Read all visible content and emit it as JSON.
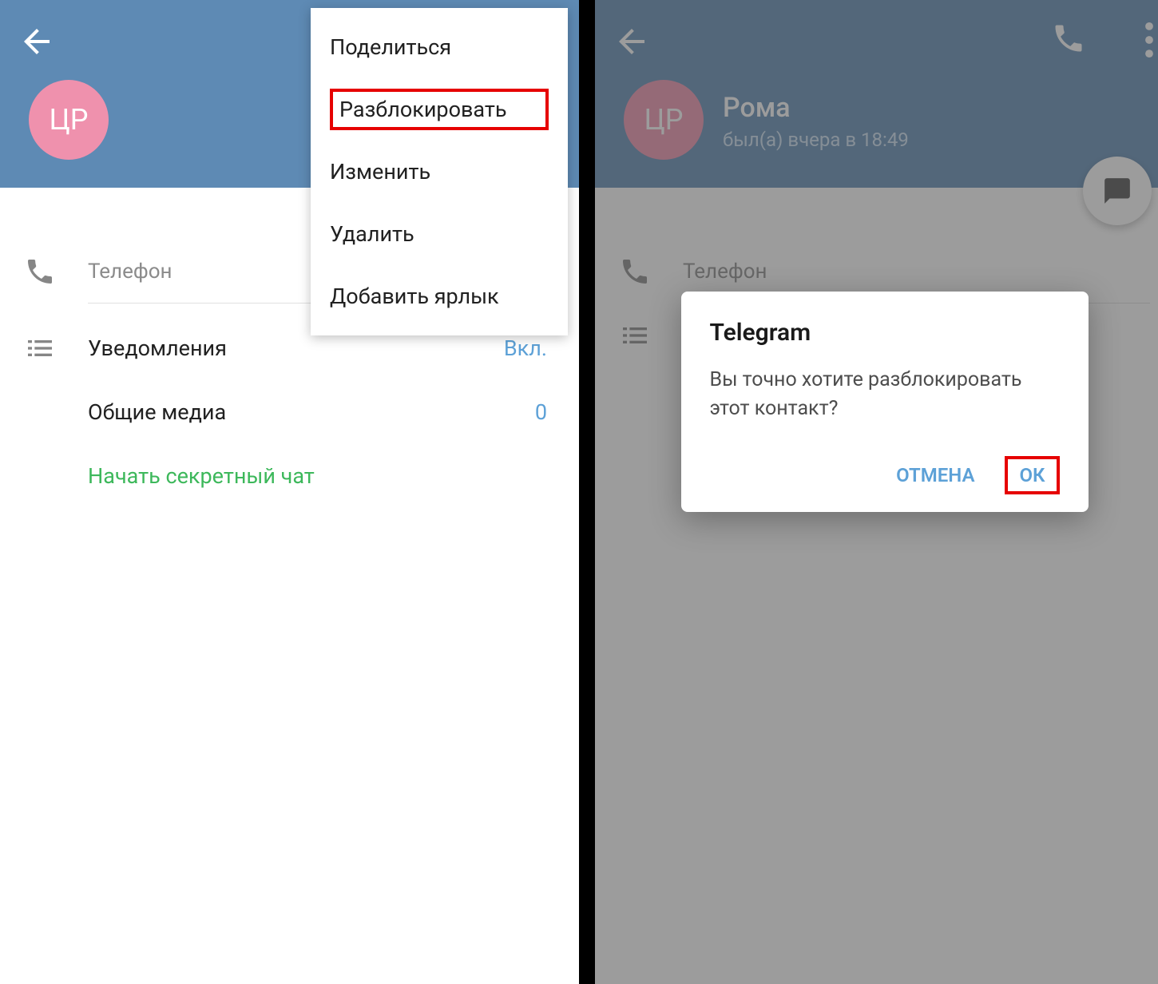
{
  "left": {
    "avatar_initials": "ЦР",
    "menu": {
      "share": "Поделиться",
      "unblock": "Разблокировать",
      "edit": "Изменить",
      "delete": "Удалить",
      "add_shortcut": "Добавить ярлык"
    },
    "phone_label": "Телефон",
    "notifications_label": "Уведомления",
    "notifications_value": "Вкл.",
    "shared_media_label": "Общие медиа",
    "shared_media_value": "0",
    "secret_chat": "Начать секретный чат"
  },
  "right": {
    "avatar_initials": "ЦР",
    "name": "Рома",
    "last_seen": "был(а) вчера в 18:49",
    "phone_label": "Телефон",
    "dialog": {
      "title": "Telegram",
      "body": "Вы точно хотите разблокировать этот контакт?",
      "cancel": "ОТМЕНА",
      "ok": "ОК"
    }
  }
}
